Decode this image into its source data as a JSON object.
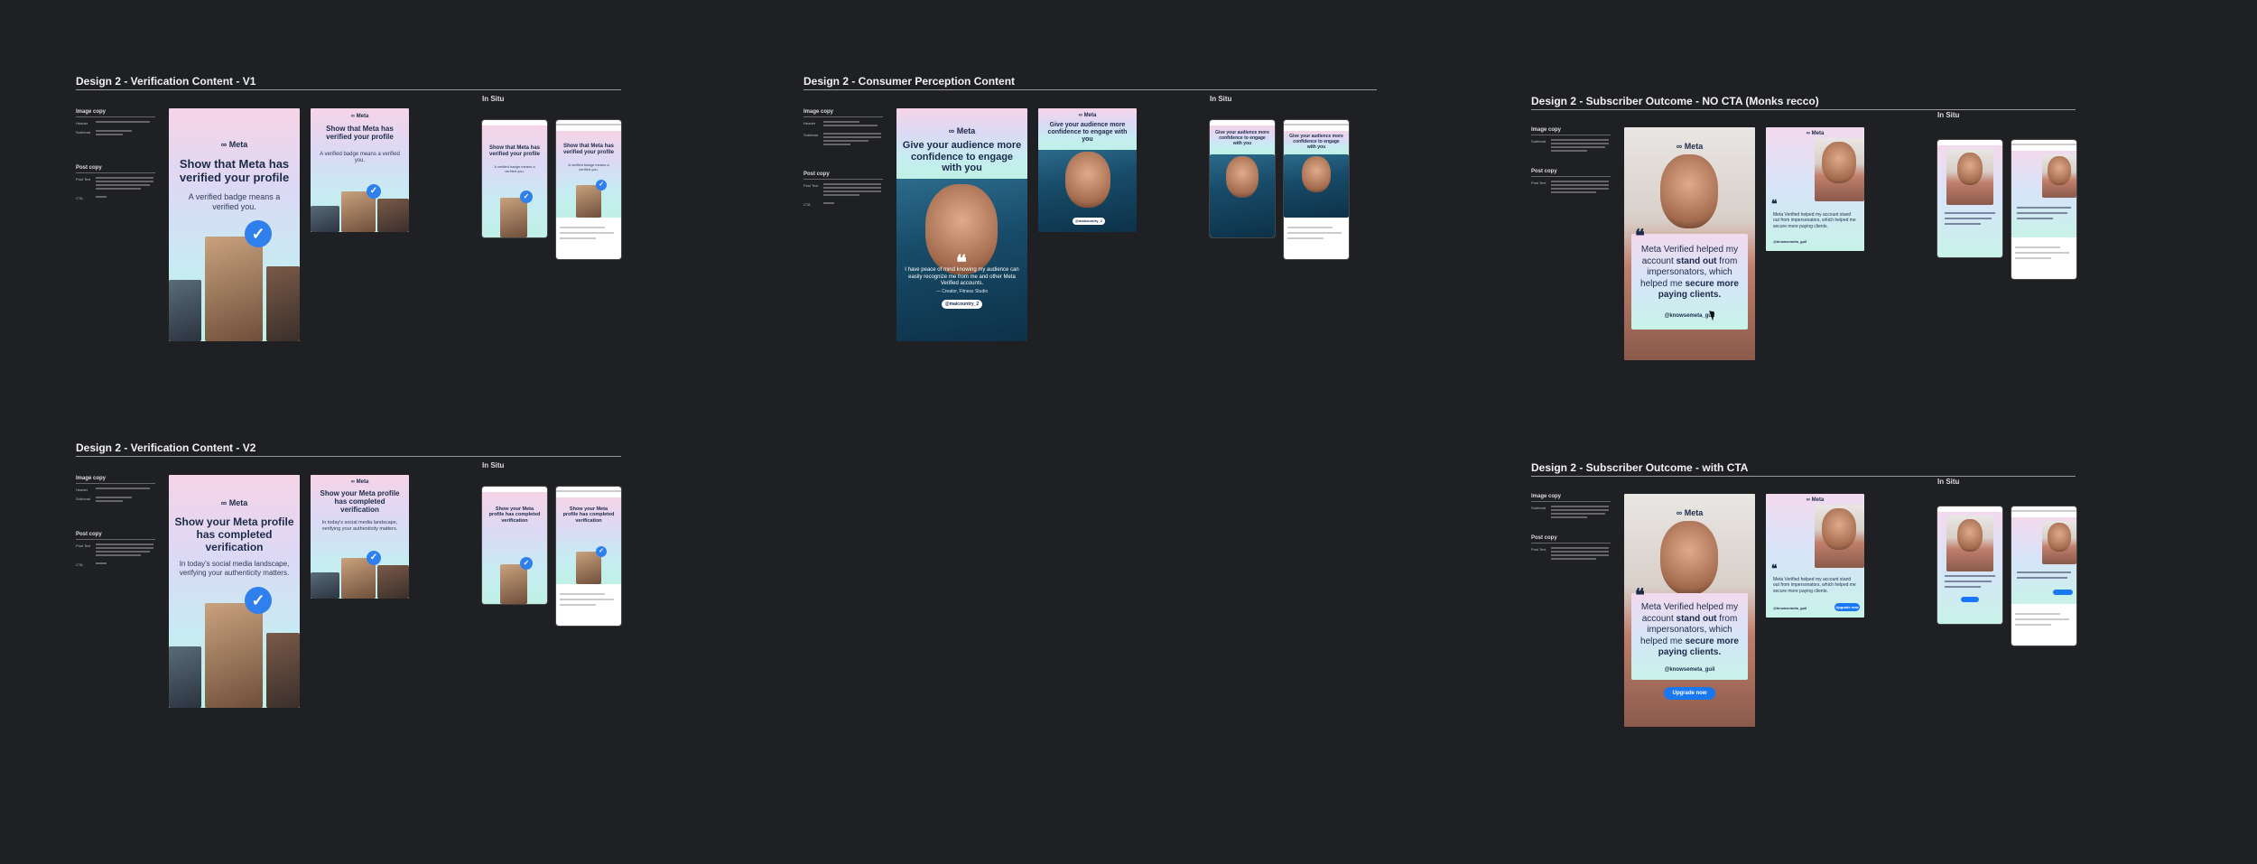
{
  "sections": [
    {
      "title": "Design 2 - Verification Content - V1",
      "insitu": "In Situ",
      "notes": {
        "image_copy": "Image copy",
        "header_key": "Header",
        "subhead_key": "Subhead",
        "post_copy": "Post copy",
        "post_key": "Post Text",
        "cta_key": "CTA"
      },
      "card": {
        "logo": "∞ Meta",
        "headline": "Show that Meta has verified your profile",
        "sub": "A verified badge means a verified you."
      },
      "thumb": {
        "logo": "∞ Meta",
        "headline": "Show that Meta has verified your profile",
        "sub": "A verified badge means a verified you."
      },
      "phone1": {
        "headline": "Show that Meta has verified your profile",
        "sub": "A verified badge means a verified you."
      },
      "phone2": {
        "headline": "Show that Meta has verified your profile",
        "sub": "A verified badge means a verified you."
      },
      "icons": {
        "badge": "check-badge-icon"
      }
    },
    {
      "title": "Design 2 - Consumer Perception Content",
      "insitu": "In Situ",
      "notes": {
        "image_copy": "Image copy",
        "header_key": "Header",
        "subhead_key": "Subhead",
        "post_copy": "Post copy",
        "post_key": "Post Text",
        "cta_key": "CTA"
      },
      "card": {
        "logo": "∞ Meta",
        "headline": "Give your audience more confidence to engage with you",
        "quote": "I have peace of mind knowing my audience can easily recognize me from me and other Meta Verified accounts.",
        "credit": "— Creator, Fitness Studio",
        "pill": "@maicountry_2"
      },
      "thumb": {
        "logo": "∞ Meta",
        "headline": "Give your audience more confidence to engage with you",
        "pill": "@maicountry_2"
      },
      "phone1": {
        "headline": "Give your audience more confidence to engage with you"
      },
      "phone2": {
        "headline": "Give your audience more confidence to engage with you"
      }
    },
    {
      "title": "Design 2 - Subscriber Outcome - NO CTA (Monks recco)",
      "insitu": "In Situ",
      "notes": {
        "image_copy": "Image copy",
        "subhead_key": "Subhead",
        "post_copy": "Post copy",
        "post_key": "Post Text"
      },
      "card": {
        "logo": "∞ Meta",
        "quote_pre": "Meta Verified helped my account ",
        "quote_b1": "stand out",
        "quote_mid": " from impersonators, which helped me ",
        "quote_b2": "secure more paying clients.",
        "handle": "@knowsemeta_guil"
      },
      "thumb": {
        "logo": "∞ Meta",
        "quote": "Meta Verified helped my account stand out from impersonators, which helped me secure more paying clients.",
        "handle": "@knowsemeta_guil"
      }
    },
    {
      "title": "Design 2 - Verification Content  - V2",
      "insitu": "In Situ",
      "notes": {
        "image_copy": "Image copy",
        "header_key": "Header",
        "subhead_key": "Subhead",
        "post_copy": "Post copy",
        "post_key": "Post Text",
        "cta_key": "CTA"
      },
      "card": {
        "logo": "∞ Meta",
        "headline": "Show your Meta profile has completed verification",
        "sub": "In today's social media landscape, verifying your authenticity matters."
      },
      "thumb": {
        "logo": "∞ Meta",
        "headline": "Show your Meta profile has completed verification",
        "sub": "In today's social media landscape, verifying your authenticity matters."
      },
      "phone1": {
        "headline": "Show your Meta profile has completed verification"
      },
      "phone2": {
        "headline": "Show your Meta profile has completed verification"
      }
    },
    {
      "title": "Design 2 - Subscriber Outcome - with CTA",
      "insitu": "In Situ",
      "notes": {
        "image_copy": "Image copy",
        "subhead_key": "Subhead",
        "post_copy": "Post copy",
        "post_key": "Post Text"
      },
      "card": {
        "logo": "∞ Meta",
        "quote_pre": "Meta Verified helped my account ",
        "quote_b1": "stand out",
        "quote_mid": " from impersonators, which helped me ",
        "quote_b2": "secure more paying clients.",
        "handle": "@knowsemeta_guil",
        "cta": "Upgrade now"
      },
      "thumb": {
        "logo": "∞ Meta",
        "quote": "Meta Verified helped my account stand out from impersonators, which helped me secure more paying clients.",
        "handle": "@knowsemeta_guil",
        "cta": "Upgrade now"
      }
    }
  ],
  "colors": {
    "background": "#1f2023",
    "accent": "#1877f2",
    "navy": "#1c2b4a"
  }
}
